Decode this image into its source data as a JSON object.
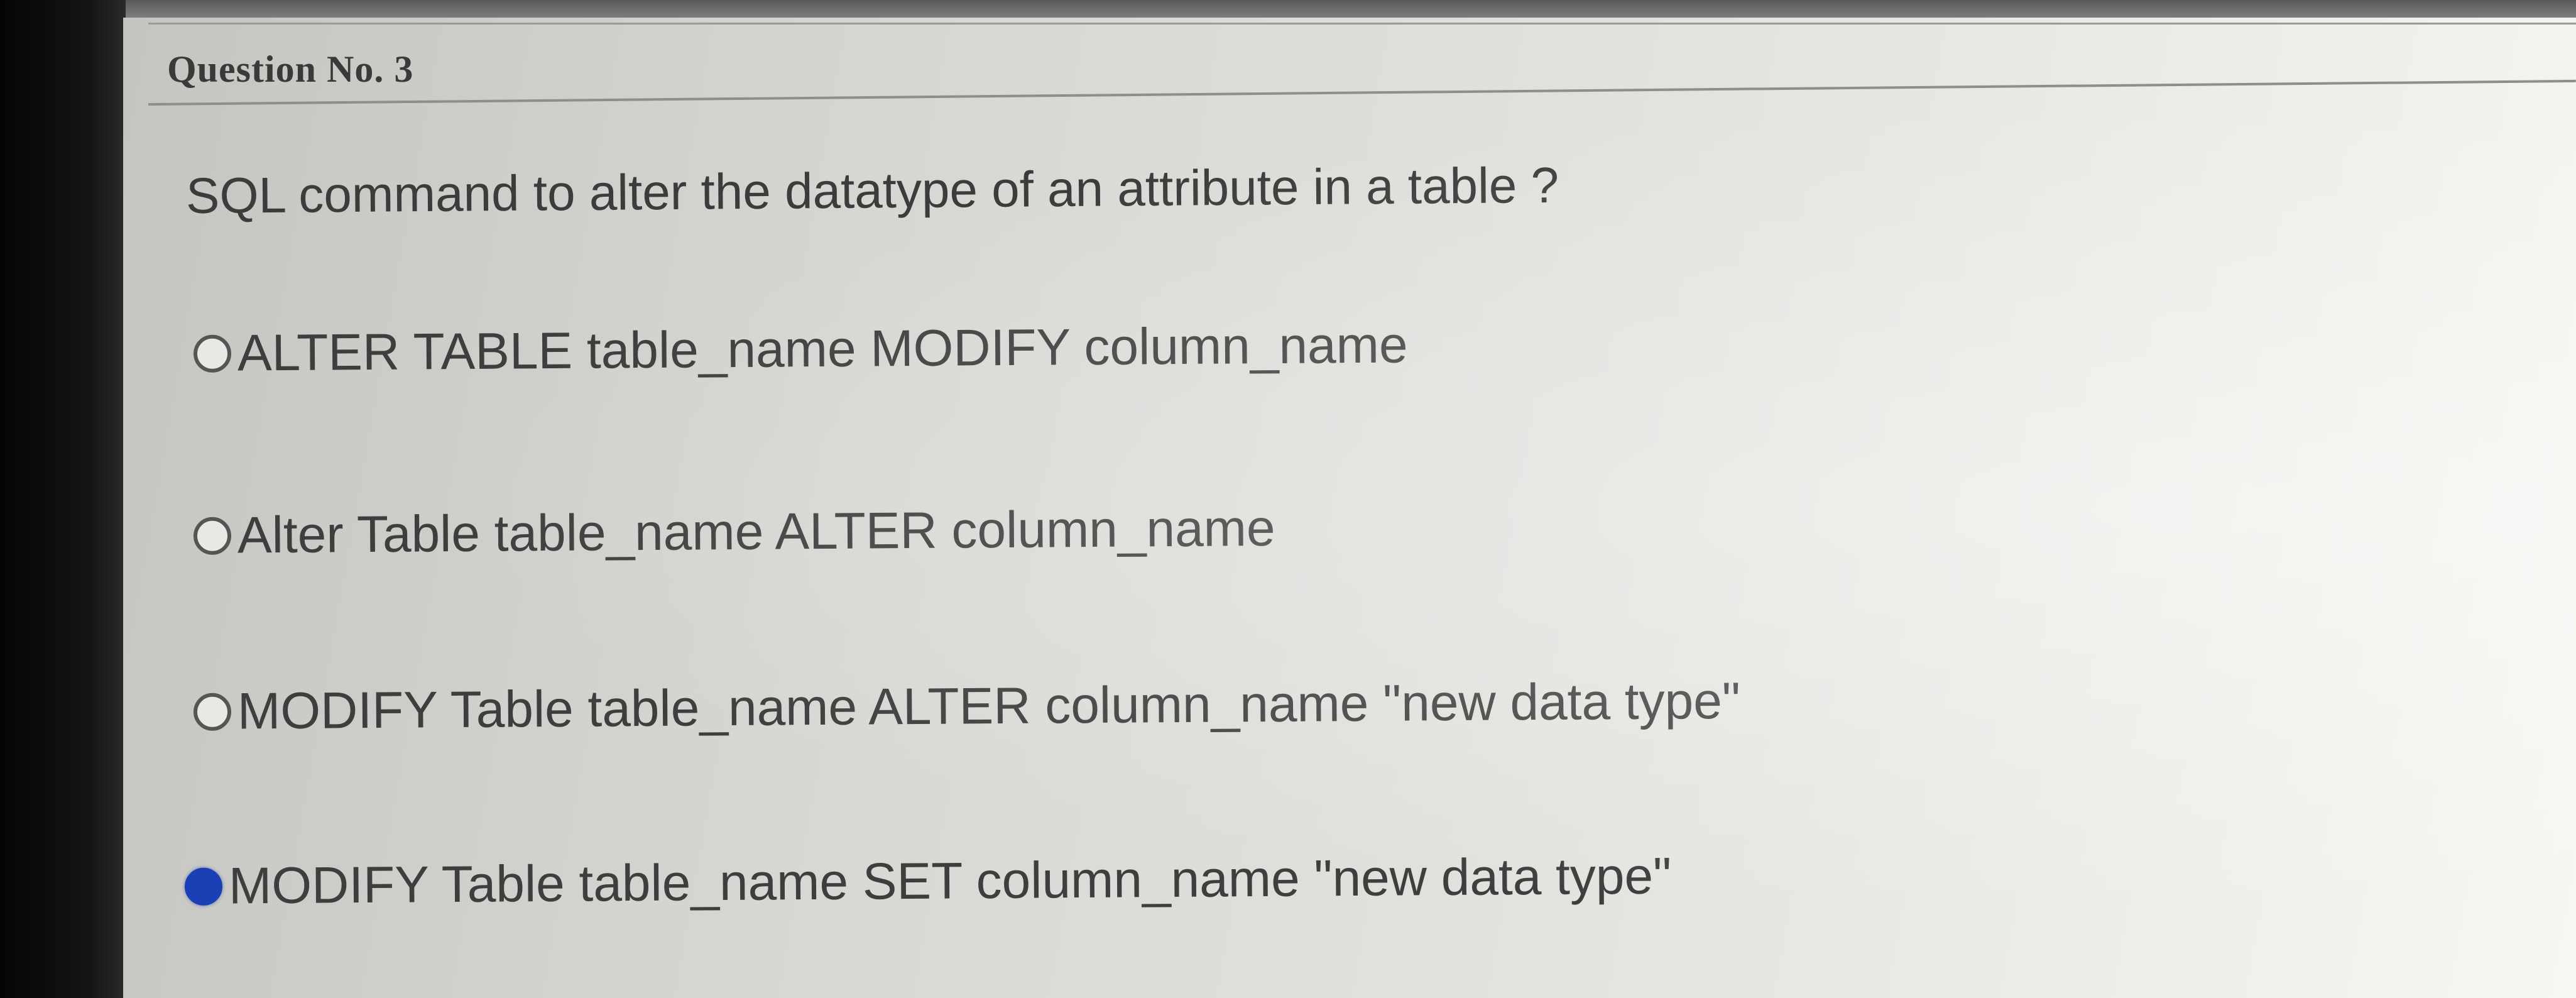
{
  "question": {
    "number_label": "Question No. 3",
    "text": "SQL command to alter the datatype of an attribute in a table ?"
  },
  "options": [
    {
      "label": "ALTER TABLE table_name MODIFY column_name",
      "selected": false
    },
    {
      "label": "Alter Table table_name ALTER column_name",
      "selected": false
    },
    {
      "label": "MODIFY Table table_name ALTER column_name \"new data type\"",
      "selected": false
    },
    {
      "label": "MODIFY Table table_name SET column_name \"new data type\"",
      "selected": true
    }
  ],
  "colors": {
    "selected_radio": "#1b3fb5",
    "text": "#3e3e3e"
  }
}
